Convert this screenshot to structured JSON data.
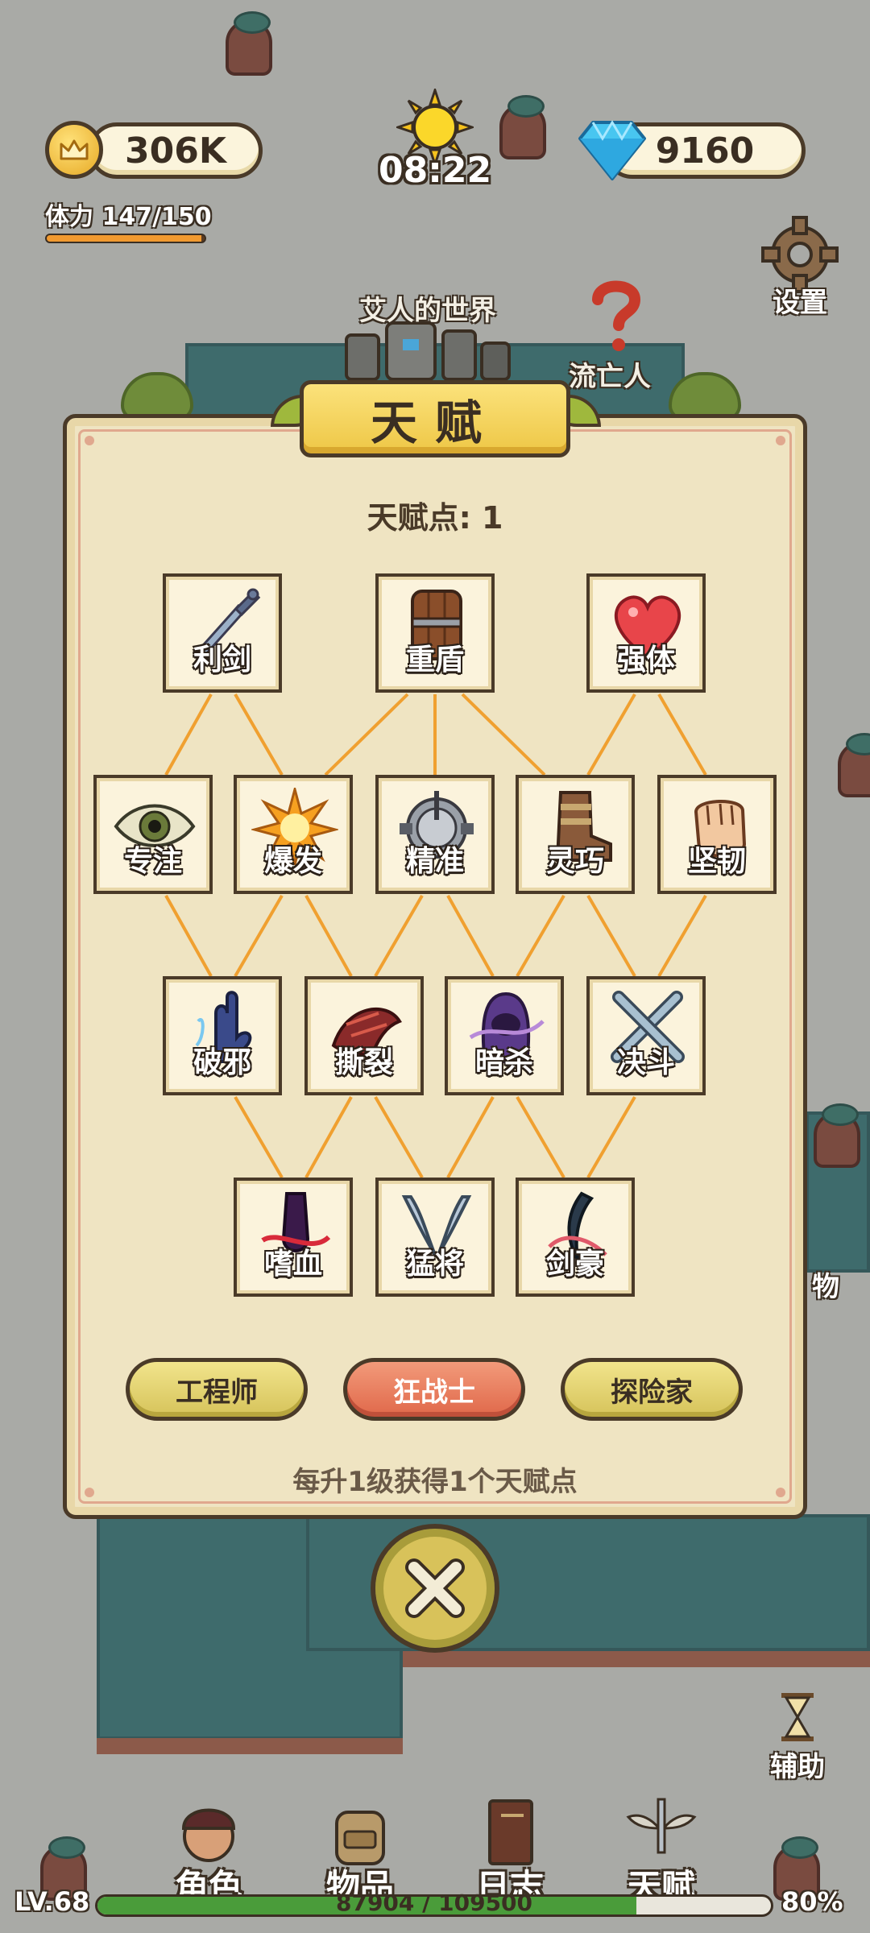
{
  "hud": {
    "gold": "306K",
    "gems": "9160",
    "stamina_label": "体力 147/150",
    "stamina_fraction": 0.98,
    "time": "08:22",
    "settings_label": "设置",
    "assist_label": "辅助",
    "items_side_label": "物"
  },
  "map": {
    "world_name": "艾人的世界",
    "npc_name": "流亡人"
  },
  "panel": {
    "title": "天赋",
    "points_label": "天赋点: 1",
    "hint": "每升1级获得1个天赋点",
    "talents": {
      "sword": "利剑",
      "shield": "重盾",
      "body": "强体",
      "focus": "专注",
      "burst": "爆发",
      "precise": "精准",
      "agile": "灵巧",
      "tough": "坚韧",
      "purge": "破邪",
      "tear": "撕裂",
      "assassin": "暗杀",
      "duel": "决斗",
      "bloodlust": "嗜血",
      "general": "猛将",
      "swordmaster": "剑豪"
    },
    "classes": [
      "工程师",
      "狂战士",
      "探险家"
    ]
  },
  "nav": {
    "character": "角色",
    "items": "物品",
    "journal": "日志",
    "talent": "天赋"
  },
  "status": {
    "level": "LV.68",
    "xp": "87904 / 109500",
    "percent": "80%",
    "xp_fraction": 0.8
  },
  "colors": {
    "panel_bg": "#efe4c2",
    "banner": "#f3d35a",
    "link_line": "#f0a030",
    "active_class": "#e0684a",
    "xp_fill": "#4a9c3a"
  }
}
